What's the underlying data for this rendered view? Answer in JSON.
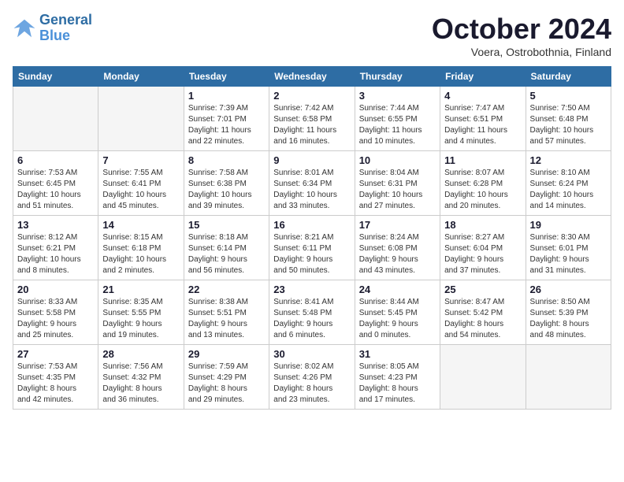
{
  "header": {
    "logo_line1": "General",
    "logo_line2": "Blue",
    "month": "October 2024",
    "location": "Voera, Ostrobothnia, Finland"
  },
  "weekdays": [
    "Sunday",
    "Monday",
    "Tuesday",
    "Wednesday",
    "Thursday",
    "Friday",
    "Saturday"
  ],
  "weeks": [
    [
      {
        "day": "",
        "empty": true
      },
      {
        "day": "",
        "empty": true
      },
      {
        "day": "1",
        "line1": "Sunrise: 7:39 AM",
        "line2": "Sunset: 7:01 PM",
        "line3": "Daylight: 11 hours",
        "line4": "and 22 minutes."
      },
      {
        "day": "2",
        "line1": "Sunrise: 7:42 AM",
        "line2": "Sunset: 6:58 PM",
        "line3": "Daylight: 11 hours",
        "line4": "and 16 minutes."
      },
      {
        "day": "3",
        "line1": "Sunrise: 7:44 AM",
        "line2": "Sunset: 6:55 PM",
        "line3": "Daylight: 11 hours",
        "line4": "and 10 minutes."
      },
      {
        "day": "4",
        "line1": "Sunrise: 7:47 AM",
        "line2": "Sunset: 6:51 PM",
        "line3": "Daylight: 11 hours",
        "line4": "and 4 minutes."
      },
      {
        "day": "5",
        "line1": "Sunrise: 7:50 AM",
        "line2": "Sunset: 6:48 PM",
        "line3": "Daylight: 10 hours",
        "line4": "and 57 minutes."
      }
    ],
    [
      {
        "day": "6",
        "line1": "Sunrise: 7:53 AM",
        "line2": "Sunset: 6:45 PM",
        "line3": "Daylight: 10 hours",
        "line4": "and 51 minutes."
      },
      {
        "day": "7",
        "line1": "Sunrise: 7:55 AM",
        "line2": "Sunset: 6:41 PM",
        "line3": "Daylight: 10 hours",
        "line4": "and 45 minutes."
      },
      {
        "day": "8",
        "line1": "Sunrise: 7:58 AM",
        "line2": "Sunset: 6:38 PM",
        "line3": "Daylight: 10 hours",
        "line4": "and 39 minutes."
      },
      {
        "day": "9",
        "line1": "Sunrise: 8:01 AM",
        "line2": "Sunset: 6:34 PM",
        "line3": "Daylight: 10 hours",
        "line4": "and 33 minutes."
      },
      {
        "day": "10",
        "line1": "Sunrise: 8:04 AM",
        "line2": "Sunset: 6:31 PM",
        "line3": "Daylight: 10 hours",
        "line4": "and 27 minutes."
      },
      {
        "day": "11",
        "line1": "Sunrise: 8:07 AM",
        "line2": "Sunset: 6:28 PM",
        "line3": "Daylight: 10 hours",
        "line4": "and 20 minutes."
      },
      {
        "day": "12",
        "line1": "Sunrise: 8:10 AM",
        "line2": "Sunset: 6:24 PM",
        "line3": "Daylight: 10 hours",
        "line4": "and 14 minutes."
      }
    ],
    [
      {
        "day": "13",
        "line1": "Sunrise: 8:12 AM",
        "line2": "Sunset: 6:21 PM",
        "line3": "Daylight: 10 hours",
        "line4": "and 8 minutes."
      },
      {
        "day": "14",
        "line1": "Sunrise: 8:15 AM",
        "line2": "Sunset: 6:18 PM",
        "line3": "Daylight: 10 hours",
        "line4": "and 2 minutes."
      },
      {
        "day": "15",
        "line1": "Sunrise: 8:18 AM",
        "line2": "Sunset: 6:14 PM",
        "line3": "Daylight: 9 hours",
        "line4": "and 56 minutes."
      },
      {
        "day": "16",
        "line1": "Sunrise: 8:21 AM",
        "line2": "Sunset: 6:11 PM",
        "line3": "Daylight: 9 hours",
        "line4": "and 50 minutes."
      },
      {
        "day": "17",
        "line1": "Sunrise: 8:24 AM",
        "line2": "Sunset: 6:08 PM",
        "line3": "Daylight: 9 hours",
        "line4": "and 43 minutes."
      },
      {
        "day": "18",
        "line1": "Sunrise: 8:27 AM",
        "line2": "Sunset: 6:04 PM",
        "line3": "Daylight: 9 hours",
        "line4": "and 37 minutes."
      },
      {
        "day": "19",
        "line1": "Sunrise: 8:30 AM",
        "line2": "Sunset: 6:01 PM",
        "line3": "Daylight: 9 hours",
        "line4": "and 31 minutes."
      }
    ],
    [
      {
        "day": "20",
        "line1": "Sunrise: 8:33 AM",
        "line2": "Sunset: 5:58 PM",
        "line3": "Daylight: 9 hours",
        "line4": "and 25 minutes."
      },
      {
        "day": "21",
        "line1": "Sunrise: 8:35 AM",
        "line2": "Sunset: 5:55 PM",
        "line3": "Daylight: 9 hours",
        "line4": "and 19 minutes."
      },
      {
        "day": "22",
        "line1": "Sunrise: 8:38 AM",
        "line2": "Sunset: 5:51 PM",
        "line3": "Daylight: 9 hours",
        "line4": "and 13 minutes."
      },
      {
        "day": "23",
        "line1": "Sunrise: 8:41 AM",
        "line2": "Sunset: 5:48 PM",
        "line3": "Daylight: 9 hours",
        "line4": "and 6 minutes."
      },
      {
        "day": "24",
        "line1": "Sunrise: 8:44 AM",
        "line2": "Sunset: 5:45 PM",
        "line3": "Daylight: 9 hours",
        "line4": "and 0 minutes."
      },
      {
        "day": "25",
        "line1": "Sunrise: 8:47 AM",
        "line2": "Sunset: 5:42 PM",
        "line3": "Daylight: 8 hours",
        "line4": "and 54 minutes."
      },
      {
        "day": "26",
        "line1": "Sunrise: 8:50 AM",
        "line2": "Sunset: 5:39 PM",
        "line3": "Daylight: 8 hours",
        "line4": "and 48 minutes."
      }
    ],
    [
      {
        "day": "27",
        "line1": "Sunrise: 7:53 AM",
        "line2": "Sunset: 4:35 PM",
        "line3": "Daylight: 8 hours",
        "line4": "and 42 minutes."
      },
      {
        "day": "28",
        "line1": "Sunrise: 7:56 AM",
        "line2": "Sunset: 4:32 PM",
        "line3": "Daylight: 8 hours",
        "line4": "and 36 minutes."
      },
      {
        "day": "29",
        "line1": "Sunrise: 7:59 AM",
        "line2": "Sunset: 4:29 PM",
        "line3": "Daylight: 8 hours",
        "line4": "and 29 minutes."
      },
      {
        "day": "30",
        "line1": "Sunrise: 8:02 AM",
        "line2": "Sunset: 4:26 PM",
        "line3": "Daylight: 8 hours",
        "line4": "and 23 minutes."
      },
      {
        "day": "31",
        "line1": "Sunrise: 8:05 AM",
        "line2": "Sunset: 4:23 PM",
        "line3": "Daylight: 8 hours",
        "line4": "and 17 minutes."
      },
      {
        "day": "",
        "empty": true
      },
      {
        "day": "",
        "empty": true
      }
    ]
  ]
}
